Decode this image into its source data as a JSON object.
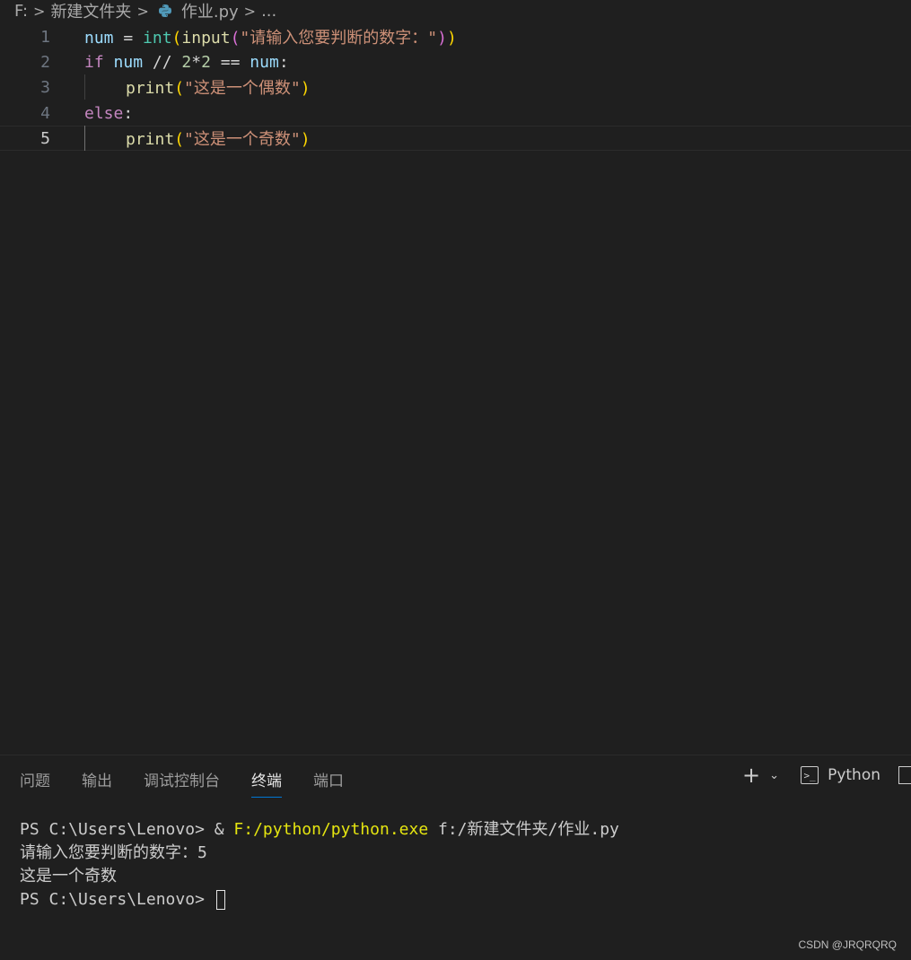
{
  "breadcrumb": {
    "drive": "F:",
    "folder": "新建文件夹",
    "file": "作业.py",
    "more": "..."
  },
  "editor": {
    "lines": [
      {
        "number": "1"
      },
      {
        "number": "2"
      },
      {
        "number": "3"
      },
      {
        "number": "4"
      },
      {
        "number": "5"
      }
    ],
    "tokens": {
      "l1_var": "num",
      "l1_eq": " = ",
      "l1_int": "int",
      "l1_p1o": "(",
      "l1_input": "input",
      "l1_p2o": "(",
      "l1_str": "\"请输入您要判断的数字：\"",
      "l1_p2c": ")",
      "l1_p1c": ")",
      "l2_if": "if",
      "l2_var": " num",
      "l2_op": " // ",
      "l2_n1": "2",
      "l2_mul": "*",
      "l2_n2": "2",
      "l2_eqeq": " == ",
      "l2_var2": "num",
      "l2_colon": ":",
      "l3_print": "print",
      "l3_po": "(",
      "l3_str": "\"这是一个偶数\"",
      "l3_pc": ")",
      "l4_else": "else",
      "l4_colon": ":",
      "l5_print": "print",
      "l5_po": "(",
      "l5_str": "\"这是一个奇数\"",
      "l5_pc": ")"
    }
  },
  "panel": {
    "tabs": [
      "问题",
      "输出",
      "调试控制台",
      "终端",
      "端口"
    ],
    "active_tab": "终端",
    "shell_label": "Python",
    "terminal": {
      "line1_prompt": "PS C:\\Users\\Lenovo> & ",
      "line1_exe": "F:/python/python.exe",
      "line1_arg": " f:/新建文件夹/作业.py",
      "line2": "请输入您要判断的数字：5",
      "line3": "这是一个奇数",
      "line4_prompt": "PS C:\\Users\\Lenovo> "
    }
  },
  "watermark": "CSDN @JRQRQRQ",
  "colors": {
    "background": "#1f1f1f",
    "keyword": "#c586c0",
    "variable": "#9cdcfe",
    "function": "#dcdcaa",
    "builtin": "#4ec9b0",
    "string": "#ce9178",
    "number": "#b5cea8",
    "tab_underline": "#0078d4"
  }
}
